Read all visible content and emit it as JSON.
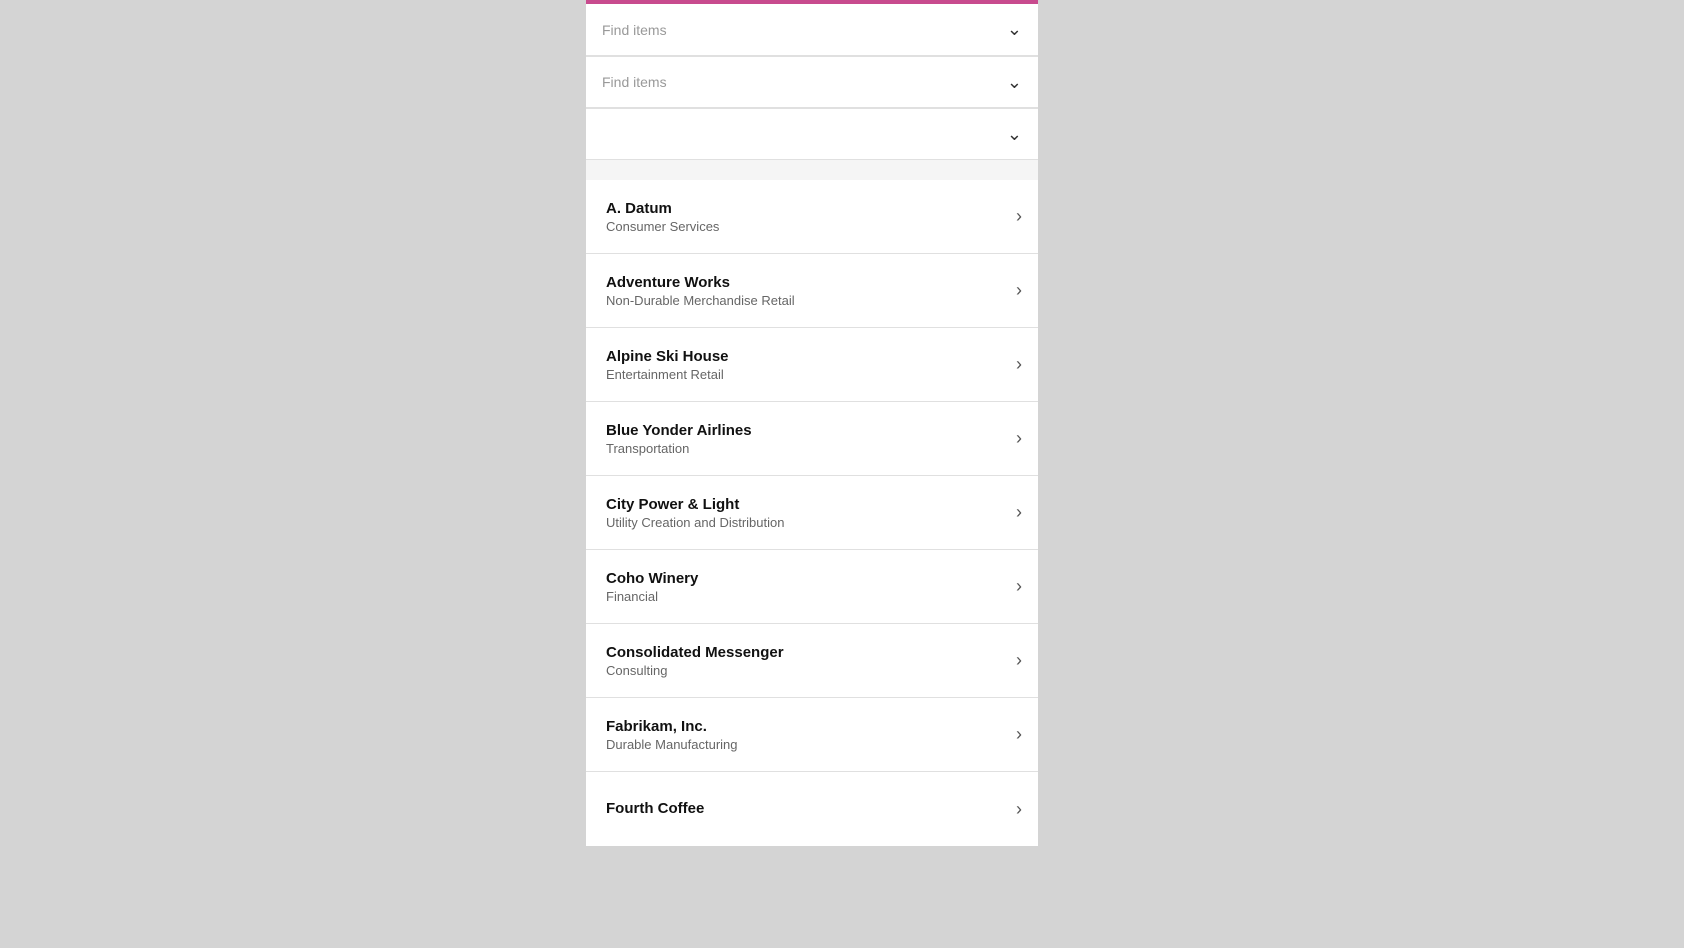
{
  "top_bar": {
    "color": "#c84b8e"
  },
  "filters": [
    {
      "placeholder": "Find items",
      "id": "filter1"
    },
    {
      "placeholder": "Find items",
      "id": "filter2"
    },
    {
      "placeholder": "",
      "id": "filter3"
    }
  ],
  "items": [
    {
      "name": "A. Datum",
      "subtitle": "Consumer Services"
    },
    {
      "name": "Adventure Works",
      "subtitle": "Non-Durable Merchandise Retail"
    },
    {
      "name": "Alpine Ski House",
      "subtitle": "Entertainment Retail"
    },
    {
      "name": "Blue Yonder Airlines",
      "subtitle": "Transportation"
    },
    {
      "name": "City Power & Light",
      "subtitle": "Utility Creation and Distribution"
    },
    {
      "name": "Coho Winery",
      "subtitle": "Financial"
    },
    {
      "name": "Consolidated Messenger",
      "subtitle": "Consulting"
    },
    {
      "name": "Fabrikam, Inc.",
      "subtitle": "Durable Manufacturing"
    },
    {
      "name": "Fourth Coffee",
      "subtitle": ""
    }
  ],
  "chevron": "›",
  "dropdown_chevron": "⌄"
}
